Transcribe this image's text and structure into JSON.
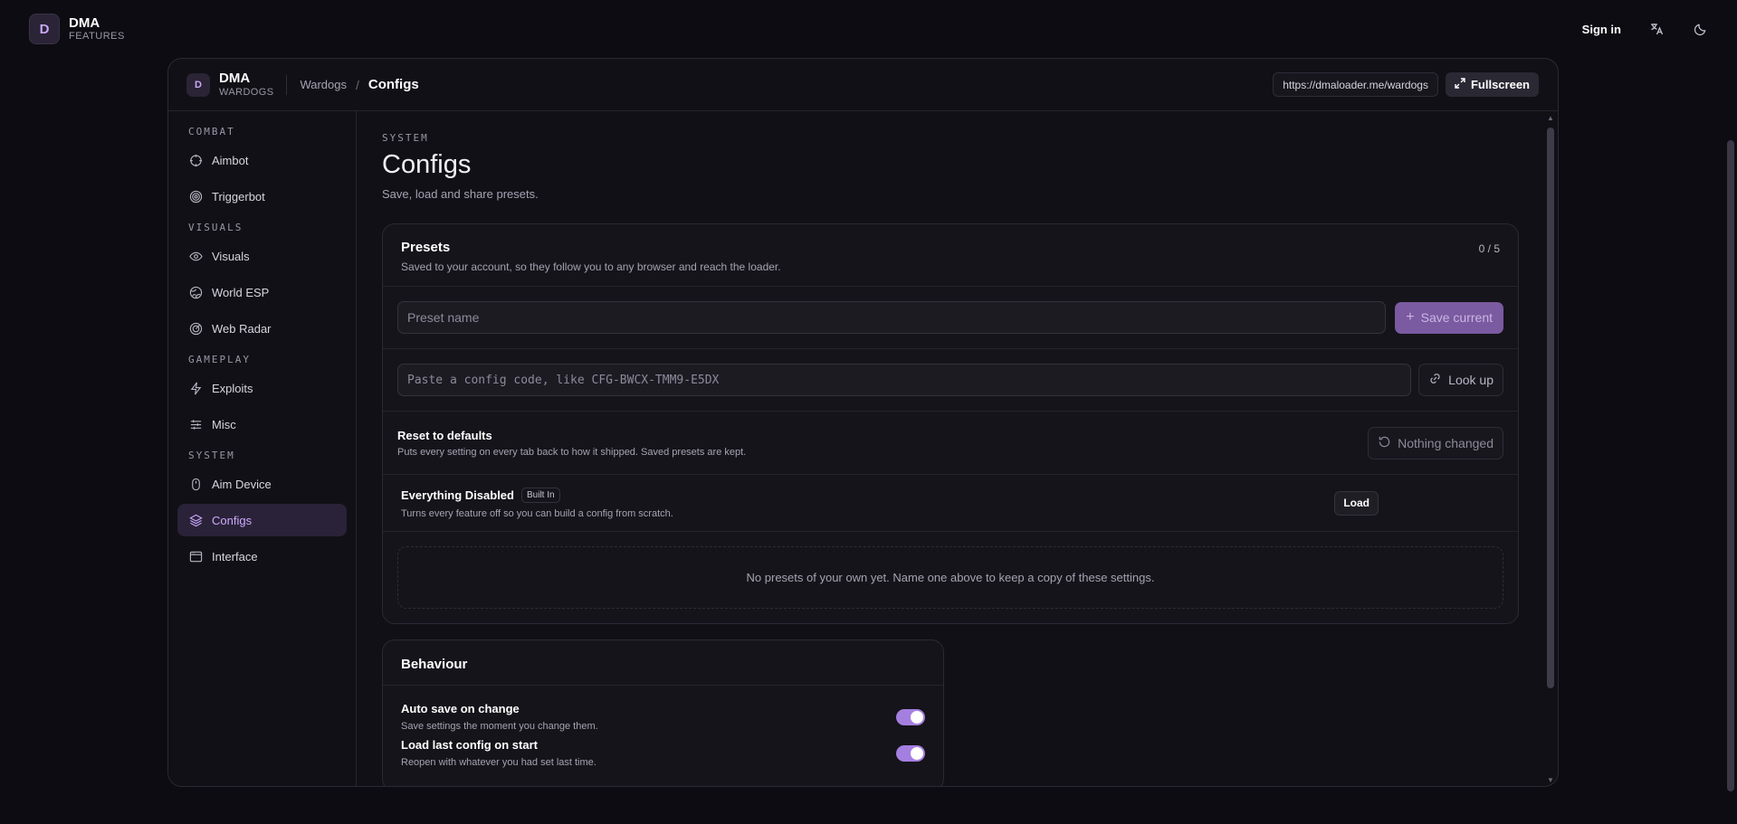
{
  "app": {
    "logo_letter": "D",
    "title": "DMA",
    "subtitle": "FEATURES",
    "signin_label": "Sign in",
    "icons": [
      "translate-icon",
      "moon-icon"
    ]
  },
  "window": {
    "logo_letter": "D",
    "title": "DMA",
    "subtitle": "WARDOGS",
    "breadcrumb_parent": "Wardogs",
    "breadcrumb_sep": "/",
    "breadcrumb_current": "Configs",
    "url": "https://dmaloader.me/wardogs",
    "fullscreen_label": "Fullscreen"
  },
  "sidebar": {
    "groups": [
      {
        "label": "COMBAT",
        "items": [
          {
            "label": "Aimbot",
            "icon": "crosshair-icon"
          },
          {
            "label": "Triggerbot",
            "icon": "target-icon"
          }
        ]
      },
      {
        "label": "VISUALS",
        "items": [
          {
            "label": "Visuals",
            "icon": "eye-icon"
          },
          {
            "label": "World ESP",
            "icon": "globe-icon"
          },
          {
            "label": "Web Radar",
            "icon": "radar-icon"
          }
        ]
      },
      {
        "label": "GAMEPLAY",
        "items": [
          {
            "label": "Exploits",
            "icon": "lightning-icon"
          },
          {
            "label": "Misc",
            "icon": "sliders-icon"
          }
        ]
      },
      {
        "label": "SYSTEM",
        "items": [
          {
            "label": "Aim Device",
            "icon": "mouse-icon"
          },
          {
            "label": "Configs",
            "icon": "layers-icon",
            "active": true
          },
          {
            "label": "Interface",
            "icon": "window-icon"
          }
        ]
      }
    ]
  },
  "main": {
    "section_label": "SYSTEM",
    "title": "Configs",
    "subtitle": "Save, load and share presets."
  },
  "presets": {
    "title": "Presets",
    "description": "Saved to your account, so they follow you to any browser and reach the loader.",
    "count": "0 / 5",
    "name_placeholder": "Preset name",
    "save_label": "Save current",
    "code_placeholder": "Paste a config code, like CFG-BWCX-TMM9-E5DX",
    "lookup_label": "Look up",
    "reset_title": "Reset to defaults",
    "reset_desc": "Puts every setting on every tab back to how it shipped. Saved presets are kept.",
    "reset_button": "Nothing changed",
    "builtin": {
      "name": "Everything Disabled",
      "badge": "Built In",
      "desc": "Turns every feature off so you can build a config from scratch.",
      "load_label": "Load"
    },
    "empty_text": "No presets of your own yet. Name one above to keep a copy of these settings."
  },
  "behaviour": {
    "title": "Behaviour",
    "toggles": [
      {
        "title": "Auto save on change",
        "desc": "Save settings the moment you change them.",
        "on": true
      },
      {
        "title": "Load last config on start",
        "desc": "Reopen with whatever you had set last time.",
        "on": true
      }
    ]
  },
  "colors": {
    "accent": "#a57fe0",
    "accent_active_text": "#cda9ff",
    "background": "#0d0c12"
  }
}
